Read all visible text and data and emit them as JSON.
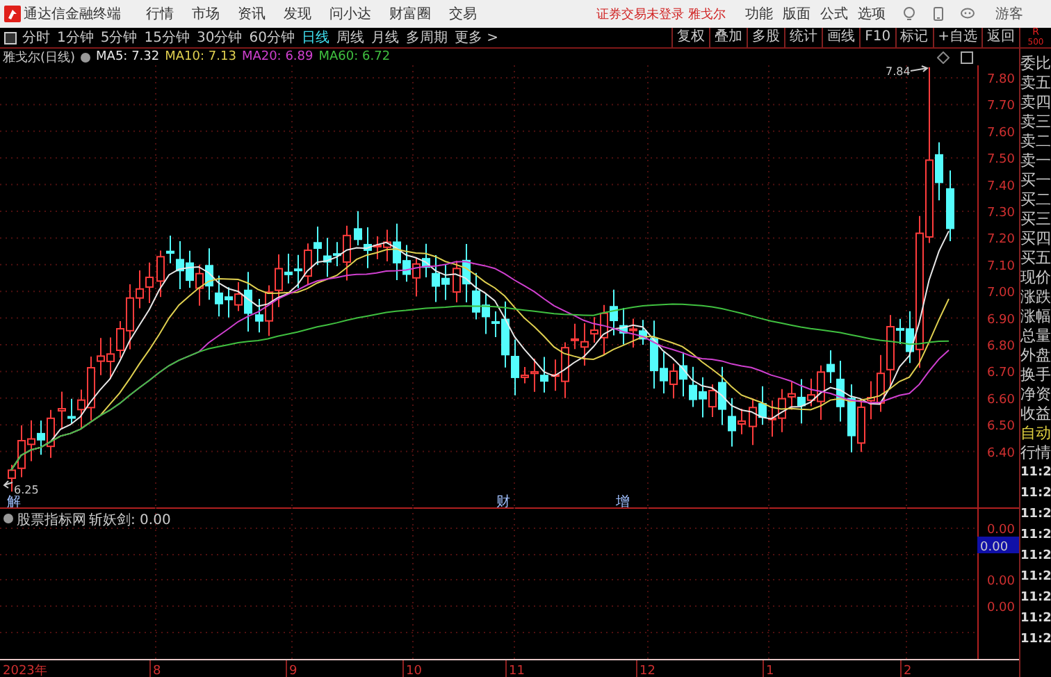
{
  "app_bar": {
    "title": "通达信金融终端",
    "menus": [
      "行情",
      "市场",
      "资讯",
      "发现",
      "问小达",
      "财富圈",
      "交易"
    ],
    "login_status": "证券交易未登录 雅戈尔",
    "tools": [
      "功能",
      "版面",
      "公式",
      "选项"
    ],
    "user": "游客"
  },
  "period_tabs": [
    {
      "label": "分时",
      "selected": false
    },
    {
      "label": "1分钟",
      "selected": false
    },
    {
      "label": "5分钟",
      "selected": false
    },
    {
      "label": "15分钟",
      "selected": false
    },
    {
      "label": "30分钟",
      "selected": false
    },
    {
      "label": "60分钟",
      "selected": false
    },
    {
      "label": "日线",
      "selected": true
    },
    {
      "label": "周线",
      "selected": false
    },
    {
      "label": "月线",
      "selected": false
    },
    {
      "label": "多周期",
      "selected": false
    },
    {
      "label": "更多 >",
      "selected": false
    }
  ],
  "actions": [
    "复权",
    "叠加",
    "多股",
    "统计",
    "画线",
    "F10",
    "标记",
    "+自选",
    "返回"
  ],
  "corner_badge": {
    "line_1": "R",
    "line_2": "500"
  },
  "chart": {
    "title": "雅戈尔(日线)",
    "indicators": [
      {
        "label": "MA5: 7.32",
        "color": "#e8e8e8"
      },
      {
        "label": "MA10: 7.13",
        "color": "#e0d050"
      },
      {
        "label": "MA20: 6.89",
        "color": "#d040d0"
      },
      {
        "label": "MA60: 6.72",
        "color": "#40c040"
      }
    ],
    "price_ticks": [
      "7.80",
      "7.70",
      "7.60",
      "7.50",
      "7.40",
      "7.30",
      "7.20",
      "7.10",
      "7.00",
      "6.90",
      "6.80",
      "6.70",
      "6.60",
      "6.50",
      "6.40"
    ],
    "high_label": "7.84",
    "low_label": "6.25",
    "markers": [
      "解",
      "财",
      "增"
    ]
  },
  "indicator_panel": {
    "name": "股票指标网",
    "reading": "斩妖剑: 0.00",
    "ticks": [
      "0.00",
      "0.00",
      "0.00"
    ],
    "current_value": "0.00"
  },
  "date_axis": [
    "2023年",
    "8",
    "9",
    "10",
    "11",
    "12",
    "1",
    "2"
  ],
  "quote_panel": {
    "labels": [
      {
        "label": "委比",
        "kind": "field"
      },
      {
        "label": "卖五",
        "kind": "field"
      },
      {
        "label": "卖四",
        "kind": "field"
      },
      {
        "label": "卖三",
        "kind": "field"
      },
      {
        "label": "卖二",
        "kind": "field"
      },
      {
        "label": "卖一",
        "kind": "field"
      },
      {
        "label": "买一",
        "kind": "field"
      },
      {
        "label": "买二",
        "kind": "field"
      },
      {
        "label": "买三",
        "kind": "field"
      },
      {
        "label": "买四",
        "kind": "field"
      },
      {
        "label": "买五",
        "kind": "field"
      },
      {
        "label": "现价",
        "kind": "field"
      },
      {
        "label": "涨跌",
        "kind": "field"
      },
      {
        "label": "涨幅",
        "kind": "field"
      },
      {
        "label": "总量",
        "kind": "field"
      },
      {
        "label": "外盘",
        "kind": "field"
      },
      {
        "label": "换手",
        "kind": "field"
      },
      {
        "label": "净资",
        "kind": "field"
      },
      {
        "label": "收益",
        "kind": "field"
      },
      {
        "label": "自动",
        "kind": "toggle"
      },
      {
        "label": "行情",
        "kind": "field"
      }
    ],
    "times": [
      "11:2",
      "11:2",
      "11:2",
      "11:2",
      "11:2",
      "11:2",
      "11:2",
      "11:2",
      "11:2"
    ]
  }
}
